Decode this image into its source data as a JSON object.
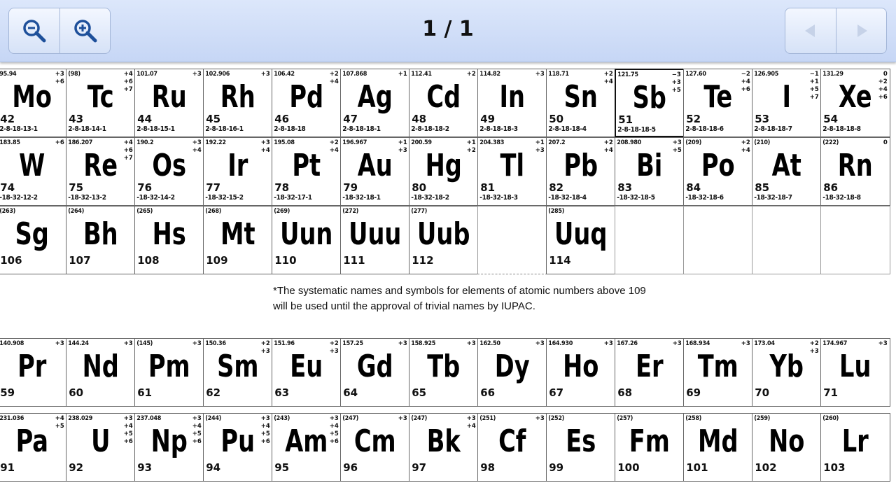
{
  "toolbar": {
    "zoom_out_icon": "zoom-out-icon",
    "zoom_in_icon": "zoom-in-icon",
    "page_indicator": "1 / 1",
    "prev_icon": "triangle-left-icon",
    "next_icon": "triangle-right-icon"
  },
  "colors": {
    "toolbar_top": "#dce7fb",
    "toolbar_bottom": "#c6d6f5",
    "disabled_arrow": "#c6d2e8"
  },
  "rows": {
    "period5": [
      {
        "mass": "95.94",
        "ox": "+3\n+6",
        "sym": "Mo",
        "num": "42",
        "conf": "2-8-18-13-1"
      },
      {
        "mass": "(98)",
        "ox": "+4\n+6\n+7",
        "sym": "Tc",
        "num": "43",
        "conf": "2-8-18-14-1"
      },
      {
        "mass": "101.07",
        "ox": "+3",
        "sym": "Ru",
        "num": "44",
        "conf": "2-8-18-15-1"
      },
      {
        "mass": "102.906",
        "ox": "+3",
        "sym": "Rh",
        "num": "45",
        "conf": "2-8-18-16-1"
      },
      {
        "mass": "106.42",
        "ox": "+2\n+4",
        "sym": "Pd",
        "num": "46",
        "conf": "2-8-18-18"
      },
      {
        "mass": "107.868",
        "ox": "+1",
        "sym": "Ag",
        "num": "47",
        "conf": "2-8-18-18-1"
      },
      {
        "mass": "112.41",
        "ox": "+2",
        "sym": "Cd",
        "num": "48",
        "conf": "2-8-18-18-2"
      },
      {
        "mass": "114.82",
        "ox": "+3",
        "sym": "In",
        "num": "49",
        "conf": "2-8-18-18-3"
      },
      {
        "mass": "118.71",
        "ox": "+2\n+4",
        "sym": "Sn",
        "num": "50",
        "conf": "2-8-18-18-4"
      },
      {
        "mass": "121.75",
        "ox": "−3\n+3\n+5",
        "sym": "Sb",
        "num": "51",
        "conf": "2-8-18-18-5"
      },
      {
        "mass": "127.60",
        "ox": "−2\n+4\n+6",
        "sym": "Te",
        "num": "52",
        "conf": "2-8-18-18-6"
      },
      {
        "mass": "126.905",
        "ox": "−1\n+1\n+5\n+7",
        "sym": "I",
        "num": "53",
        "conf": "2-8-18-18-7"
      },
      {
        "mass": "131.29",
        "ox": "0\n+2\n+4\n+6",
        "sym": "Xe",
        "num": "54",
        "conf": "2-8-18-18-8"
      }
    ],
    "period6": [
      {
        "mass": "183.85",
        "ox": "+6",
        "sym": "W",
        "num": "74",
        "conf": "-18-32-12-2"
      },
      {
        "mass": "186.207",
        "ox": "+4\n+6\n+7",
        "sym": "Re",
        "num": "75",
        "conf": "-18-32-13-2"
      },
      {
        "mass": "190.2",
        "ox": "+3\n+4",
        "sym": "Os",
        "num": "76",
        "conf": "-18-32-14-2"
      },
      {
        "mass": "192.22",
        "ox": "+3\n+4",
        "sym": "Ir",
        "num": "77",
        "conf": "-18-32-15-2"
      },
      {
        "mass": "195.08",
        "ox": "+2\n+4",
        "sym": "Pt",
        "num": "78",
        "conf": "-18-32-17-1"
      },
      {
        "mass": "196.967",
        "ox": "+1\n+3",
        "sym": "Au",
        "num": "79",
        "conf": "-18-32-18-1"
      },
      {
        "mass": "200.59",
        "ox": "+1\n+2",
        "sym": "Hg",
        "num": "80",
        "conf": "-18-32-18-2"
      },
      {
        "mass": "204.383",
        "ox": "+1\n+3",
        "sym": "Tl",
        "num": "81",
        "conf": "-18-32-18-3"
      },
      {
        "mass": "207.2",
        "ox": "+2\n+4",
        "sym": "Pb",
        "num": "82",
        "conf": "-18-32-18-4"
      },
      {
        "mass": "208.980",
        "ox": "+3\n+5",
        "sym": "Bi",
        "num": "83",
        "conf": "-18-32-18-5"
      },
      {
        "mass": "(209)",
        "ox": "+2\n+4",
        "sym": "Po",
        "num": "84",
        "conf": "-18-32-18-6"
      },
      {
        "mass": "(210)",
        "ox": "",
        "sym": "At",
        "num": "85",
        "conf": "-18-32-18-7"
      },
      {
        "mass": "(222)",
        "ox": "0",
        "sym": "Rn",
        "num": "86",
        "conf": "-18-32-18-8"
      }
    ],
    "period7": [
      {
        "mass": "(263)",
        "ox": "",
        "sym": "Sg",
        "num": "106",
        "conf": ""
      },
      {
        "mass": "(264)",
        "ox": "",
        "sym": "Bh",
        "num": "107",
        "conf": ""
      },
      {
        "mass": "(265)",
        "ox": "",
        "sym": "Hs",
        "num": "108",
        "conf": ""
      },
      {
        "mass": "(268)",
        "ox": "",
        "sym": "Mt",
        "num": "109",
        "conf": ""
      },
      {
        "mass": "(269)",
        "ox": "",
        "sym": "Uun",
        "num": "110",
        "conf": ""
      },
      {
        "mass": "(272)",
        "ox": "",
        "sym": "Uuu",
        "num": "111",
        "conf": ""
      },
      {
        "mass": "(277)",
        "ox": "",
        "sym": "Uub",
        "num": "112",
        "conf": ""
      },
      {
        "empty": true
      },
      {
        "mass": "(285)",
        "ox": "",
        "sym": "Uuq",
        "num": "114",
        "conf": ""
      },
      {
        "empty": true
      },
      {
        "empty": true
      },
      {
        "empty": true
      },
      {
        "empty": true
      }
    ],
    "lanthanides": [
      {
        "mass": "140.908",
        "ox": "+3",
        "sym": "Pr",
        "num": "59",
        "conf": ""
      },
      {
        "mass": "144.24",
        "ox": "+3",
        "sym": "Nd",
        "num": "60",
        "conf": ""
      },
      {
        "mass": "(145)",
        "ox": "+3",
        "sym": "Pm",
        "num": "61",
        "conf": ""
      },
      {
        "mass": "150.36",
        "ox": "+2\n+3",
        "sym": "Sm",
        "num": "62",
        "conf": ""
      },
      {
        "mass": "151.96",
        "ox": "+2\n+3",
        "sym": "Eu",
        "num": "63",
        "conf": ""
      },
      {
        "mass": "157.25",
        "ox": "+3",
        "sym": "Gd",
        "num": "64",
        "conf": ""
      },
      {
        "mass": "158.925",
        "ox": "+3",
        "sym": "Tb",
        "num": "65",
        "conf": ""
      },
      {
        "mass": "162.50",
        "ox": "+3",
        "sym": "Dy",
        "num": "66",
        "conf": ""
      },
      {
        "mass": "164.930",
        "ox": "+3",
        "sym": "Ho",
        "num": "67",
        "conf": ""
      },
      {
        "mass": "167.26",
        "ox": "+3",
        "sym": "Er",
        "num": "68",
        "conf": ""
      },
      {
        "mass": "168.934",
        "ox": "+3",
        "sym": "Tm",
        "num": "69",
        "conf": ""
      },
      {
        "mass": "173.04",
        "ox": "+2\n+3",
        "sym": "Yb",
        "num": "70",
        "conf": ""
      },
      {
        "mass": "174.967",
        "ox": "+3",
        "sym": "Lu",
        "num": "71",
        "conf": ""
      }
    ],
    "actinides": [
      {
        "mass": "231.036",
        "ox": "+4\n+5",
        "sym": "Pa",
        "num": "91",
        "conf": ""
      },
      {
        "mass": "238.029",
        "ox": "+3\n+4\n+5\n+6",
        "sym": "U",
        "num": "92",
        "conf": ""
      },
      {
        "mass": "237.048",
        "ox": "+3\n+4\n+5\n+6",
        "sym": "Np",
        "num": "93",
        "conf": ""
      },
      {
        "mass": "(244)",
        "ox": "+3\n+4\n+5\n+6",
        "sym": "Pu",
        "num": "94",
        "conf": ""
      },
      {
        "mass": "(243)",
        "ox": "+3\n+4\n+5\n+6",
        "sym": "Am",
        "num": "95",
        "conf": ""
      },
      {
        "mass": "(247)",
        "ox": "+3",
        "sym": "Cm",
        "num": "96",
        "conf": ""
      },
      {
        "mass": "(247)",
        "ox": "+3\n+4",
        "sym": "Bk",
        "num": "97",
        "conf": ""
      },
      {
        "mass": "(251)",
        "ox": "+3",
        "sym": "Cf",
        "num": "98",
        "conf": ""
      },
      {
        "mass": "(252)",
        "ox": "",
        "sym": "Es",
        "num": "99",
        "conf": ""
      },
      {
        "mass": "(257)",
        "ox": "",
        "sym": "Fm",
        "num": "100",
        "conf": ""
      },
      {
        "mass": "(258)",
        "ox": "",
        "sym": "Md",
        "num": "101",
        "conf": ""
      },
      {
        "mass": "(259)",
        "ox": "",
        "sym": "No",
        "num": "102",
        "conf": ""
      },
      {
        "mass": "(260)",
        "ox": "",
        "sym": "Lr",
        "num": "103",
        "conf": ""
      }
    ]
  },
  "footnote": {
    "line1": "*The systematic names and symbols for elements of atomic numbers above 109",
    "line2": "will be used until the approval of trivial names by IUPAC."
  }
}
